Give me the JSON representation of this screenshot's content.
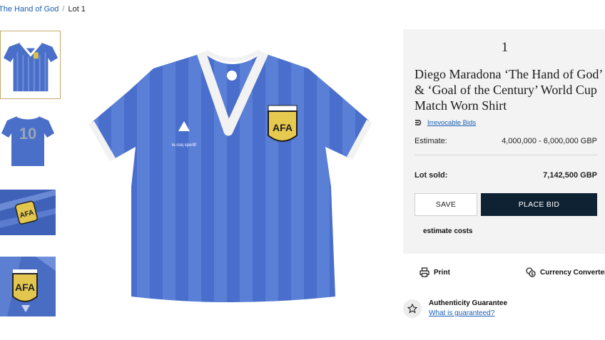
{
  "breadcrumb": {
    "parent": "The Hand of God",
    "separator": "/",
    "current": "Lot 1"
  },
  "gallery": {
    "thumbnails": [
      {
        "icon": "shirt-front-thumbnail",
        "selected": true
      },
      {
        "icon": "shirt-back-number-10-thumbnail",
        "label": "10"
      },
      {
        "icon": "badge-detail-thumbnail"
      },
      {
        "icon": "badge-closeup-thumbnail"
      }
    ],
    "main": {
      "icon": "shirt-front-image",
      "badge_text": "AFA",
      "brand_text": "le coq sportif"
    }
  },
  "lot": {
    "number": "1",
    "title": "Diego Maradona ‘The Hand of God’ & ‘Goal of the Century’ World Cup Match Worn Shirt",
    "irrevocable_bids": "Irrevocable Bids",
    "estimate_label": "Estimate:",
    "estimate_value": "4,000,000 - 6,000,000 GBP",
    "sold_label": "Lot sold:",
    "sold_value": "7,142,500 GBP",
    "save_label": "SAVE",
    "bid_label": "PLACE BID",
    "estimate_costs": "estimate costs"
  },
  "tools": {
    "print_label": "Print",
    "currency_label": "Currency Converter"
  },
  "authenticity": {
    "title": "Authenticity Guarantee",
    "link": "What is guaranteed?"
  },
  "colors": {
    "shirt_blue": "#4a6fc9",
    "dark_button": "#0f2233",
    "link_blue": "#1a5fb4",
    "thumb_border": "#c6a96b"
  }
}
